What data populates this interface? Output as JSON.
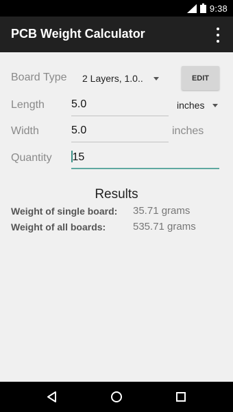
{
  "status": {
    "time": "9:38"
  },
  "app": {
    "title": "PCB Weight Calculator"
  },
  "form": {
    "board_type": {
      "label": "Board Type",
      "value": "2 Layers, 1.0..",
      "edit_label": "EDIT"
    },
    "length": {
      "label": "Length",
      "value": "5.0",
      "unit": "inches"
    },
    "width": {
      "label": "Width",
      "value": "5.0",
      "unit": "inches"
    },
    "quantity": {
      "label": "Quantity",
      "value": "15"
    }
  },
  "results": {
    "title": "Results",
    "single": {
      "label": "Weight of single board:",
      "value": "35.71 grams"
    },
    "all": {
      "label": "Weight of all boards:",
      "value": "535.71 grams"
    }
  },
  "colors": {
    "app_bar": "#212121",
    "accent": "#5fa8a0",
    "background": "#f0f0f0"
  }
}
